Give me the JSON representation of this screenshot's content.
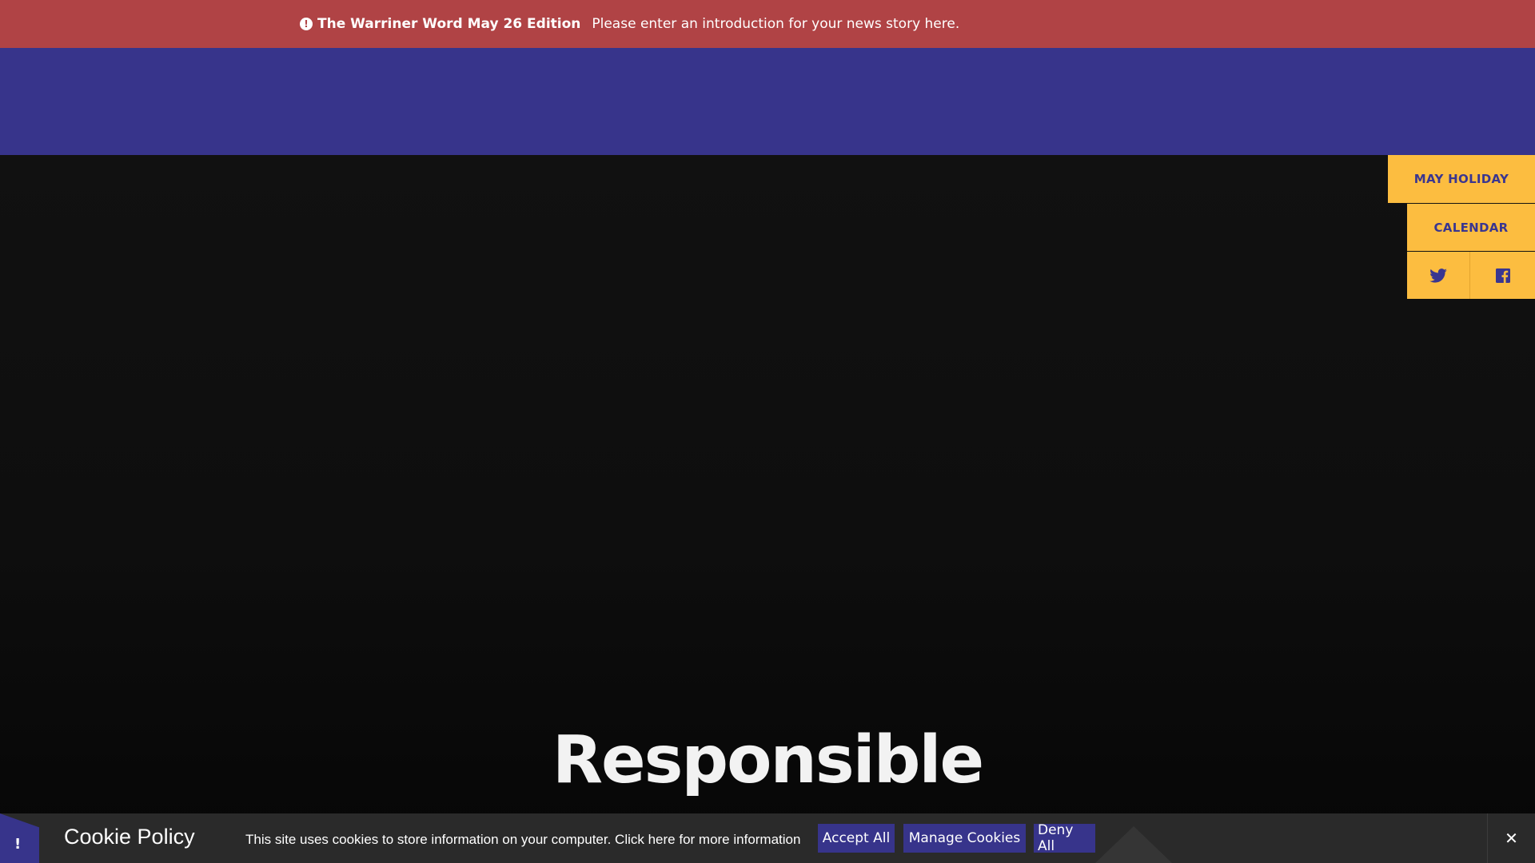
{
  "alert": {
    "icon": "exclamation-circle-icon",
    "title": "The Warriner Word May 26 Edition",
    "text": "Please enter an introduction for your news story here."
  },
  "hero": {
    "heading": "Responsible"
  },
  "side_links": {
    "holiday": "MAY HOLIDAY",
    "calendar": "CALENDAR",
    "twitter_icon": "twitter-icon",
    "facebook_icon": "facebook-icon"
  },
  "cookie": {
    "flag_icon_glyph": "!",
    "title": "Cookie Policy",
    "text": "This site uses cookies to store information on your computer. Click here for more information",
    "accept": "Accept All",
    "manage": "Manage Cookies",
    "deny": "Deny All",
    "close_glyph": "✕"
  },
  "colors": {
    "alert_bg": "#b04345",
    "header_bg": "#37348b",
    "accent_yellow": "#fcbd40",
    "cookie_bg": "#2a2a2a"
  }
}
